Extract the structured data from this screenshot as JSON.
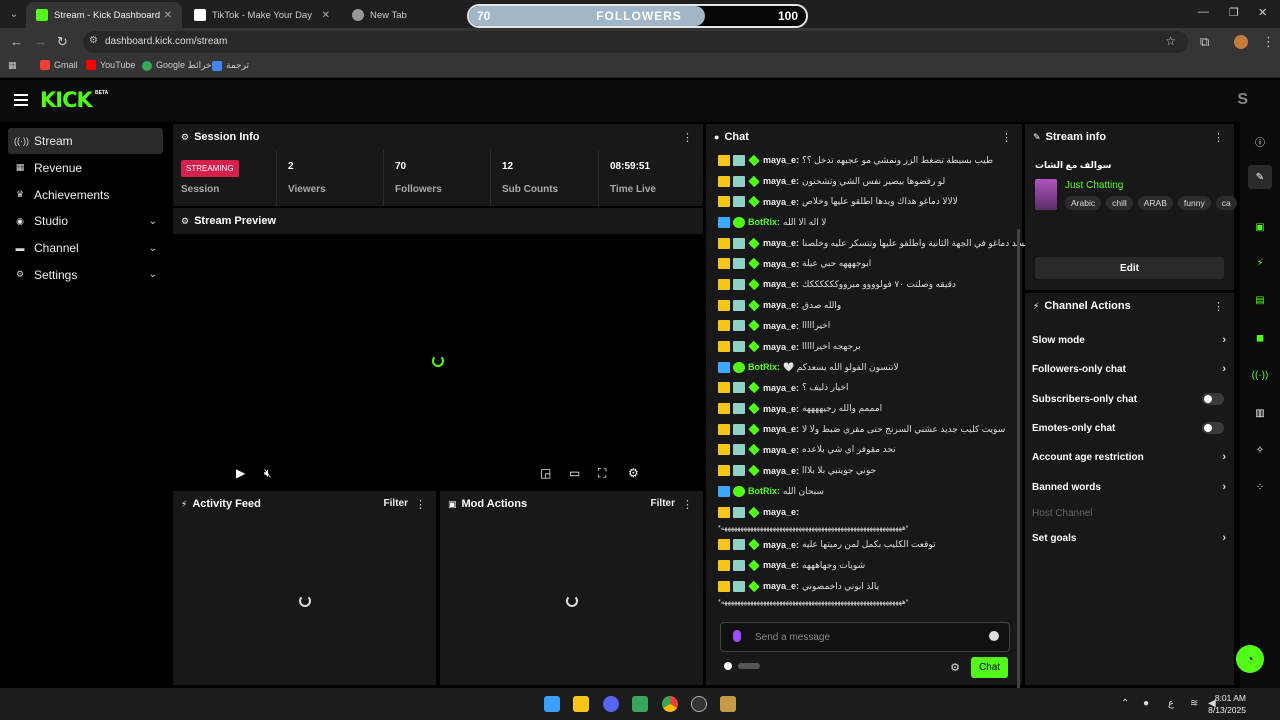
{
  "browser": {
    "tabs": [
      {
        "title": "Stream - Kick Dashboard",
        "active": true,
        "color": "#53fc18"
      },
      {
        "title": "TikTok - Make Your Day",
        "active": false,
        "color": "#ffffff"
      },
      {
        "title": "New Tab",
        "active": false,
        "color": "#999999"
      }
    ],
    "url": "dashboard.kick.com/stream",
    "bookmarks": [
      {
        "label": "Gmail",
        "color": "#ea4335"
      },
      {
        "label": "YouTube",
        "color": "#ff0000"
      },
      {
        "label": "Google خرائط",
        "color": "#34a853"
      },
      {
        "label": "ترجمة",
        "color": "#4285f4"
      }
    ]
  },
  "followers_goal": {
    "current": "70",
    "label": "FOLLOWERS",
    "goal": "100",
    "progress_fraction": 0.7
  },
  "header": {
    "logo": "KICK",
    "beta": "BETA",
    "user_initial": "S"
  },
  "nav": {
    "items": [
      {
        "label": "Stream",
        "icon": "stream-icon",
        "glyph": "((·))",
        "active": true,
        "expandable": false
      },
      {
        "label": "Revenue",
        "icon": "revenue-icon",
        "glyph": "▦",
        "active": false,
        "expandable": false
      },
      {
        "label": "Achievements",
        "icon": "trophy-icon",
        "glyph": "♛",
        "active": false,
        "expandable": false
      },
      {
        "label": "Studio",
        "icon": "studio-icon",
        "glyph": "◉",
        "active": false,
        "expandable": true
      },
      {
        "label": "Channel",
        "icon": "channel-icon",
        "glyph": "▬",
        "active": false,
        "expandable": true
      },
      {
        "label": "Settings",
        "icon": "gear-icon",
        "glyph": "⚙",
        "active": false,
        "expandable": true
      }
    ]
  },
  "session": {
    "title": "Session Info",
    "status_badge": "STREAMING",
    "stats": [
      {
        "value": "",
        "label": "Session"
      },
      {
        "value": "2",
        "label": "Viewers"
      },
      {
        "value": "70",
        "label": "Followers"
      },
      {
        "value": "12",
        "label": "Sub Counts"
      },
      {
        "value": "08:59:51",
        "label": "Time Live"
      }
    ]
  },
  "preview": {
    "title": "Stream Preview"
  },
  "activity": {
    "title": "Activity Feed",
    "filter": "Filter"
  },
  "mod_actions": {
    "title": "Mod Actions",
    "filter": "Filter"
  },
  "chat": {
    "title": "Chat",
    "messages": [
      {
        "user": "maya_e:",
        "text": "طيب بسيطة تضغط الزر ونمشي مو عجبهه تدخل ؟؟",
        "bot": false
      },
      {
        "user": "maya_e:",
        "text": "لو رفضوها بيصير نفس الشي وتشحنون",
        "bot": false
      },
      {
        "user": "maya_e:",
        "text": "لالالا دماغو هذاك ويدها اطلقو عليها وخلاص",
        "bot": false
      },
      {
        "user": "BotRix:",
        "text": "لا اله الا الله",
        "bot": true
      },
      {
        "user": "maya_e:",
        "text": "لالالا يقسد دماغو في الجهة الثانية واطلقو عليها وتتسكر عليه وخلصنا",
        "bot": false
      },
      {
        "user": "maya_e:",
        "text": "ابوجهههه حبي عيلة",
        "bot": false
      },
      {
        "user": "maya_e:",
        "text": "دقيقه وصلتت ٧٠ فولوووو مبرووككككككك",
        "bot": false
      },
      {
        "user": "maya_e:",
        "text": "والله صدق",
        "bot": false
      },
      {
        "user": "maya_e:",
        "text": "اخيرااااا",
        "bot": false
      },
      {
        "user": "maya_e:",
        "text": "برجهجه اخيرااااا",
        "bot": false
      },
      {
        "user": "BotRix:",
        "text": "لاتنسون الفولو الله يسعدكم 🤍",
        "bot": true
      },
      {
        "user": "maya_e:",
        "text": "اخيار ذليف ؟",
        "bot": false
      },
      {
        "user": "maya_e:",
        "text": "امممم والله رجيههههه",
        "bot": false
      },
      {
        "user": "maya_e:",
        "text": "سويت كليب جديد عشني السرنج حتى مقري ضبط ولا لا",
        "bot": false
      },
      {
        "user": "maya_e:",
        "text": "نحد مقوفر اي شي بلاعده",
        "bot": false
      },
      {
        "user": "maya_e:",
        "text": "جوني جويتبي بلا بلااا",
        "bot": false
      },
      {
        "user": "BotRix:",
        "text": "سبحان الله",
        "bot": true
      },
      {
        "user": "maya_e:",
        "text": "",
        "bot": false,
        "continuation": "*ههههههههههههههههههههههههههههههههههههههههههههههههههههههههه*"
      },
      {
        "user": "maya_e:",
        "text": "توقعت الكليب بكمل لمن رميتها عليه",
        "bot": false
      },
      {
        "user": "maya_e:",
        "text": "شويات وجهاهههه",
        "bot": false
      },
      {
        "user": "maya_e:",
        "text": "يالذ ابوني داخمصوني",
        "bot": false,
        "continuation": "*ههههههههههههههههههههههههههههههههههههههههههههههههههههههههه*"
      }
    ],
    "input_placeholder": "Send a message",
    "send_label": "Chat"
  },
  "stream_info": {
    "title": "Stream info",
    "stream_title": "سوالف مع الشات",
    "category": "Just Chatting",
    "tags": [
      "Arabic",
      "chill",
      "ARAB",
      "funny",
      "ca"
    ],
    "edit_label": "Edit"
  },
  "channel_actions": {
    "title": "Channel Actions",
    "items": [
      {
        "label": "Slow mode",
        "control": "chevron"
      },
      {
        "label": "Followers-only chat",
        "control": "chevron"
      },
      {
        "label": "Subscribers-only chat",
        "control": "toggle",
        "on": false
      },
      {
        "label": "Emotes-only chat",
        "control": "toggle",
        "on": false
      },
      {
        "label": "Account age restriction",
        "control": "chevron"
      },
      {
        "label": "Banned words",
        "control": "chevron"
      },
      {
        "label": "Host Channel",
        "control": "none",
        "disabled": true
      },
      {
        "label": "Set goals",
        "control": "chevron"
      }
    ]
  },
  "taskbar": {
    "time": "8:01 AM",
    "date": "8/13/2025",
    "lang": "ع"
  },
  "colors": {
    "accent": "#53fc18",
    "streaming": "#d61f4b",
    "panel": "#181818"
  }
}
